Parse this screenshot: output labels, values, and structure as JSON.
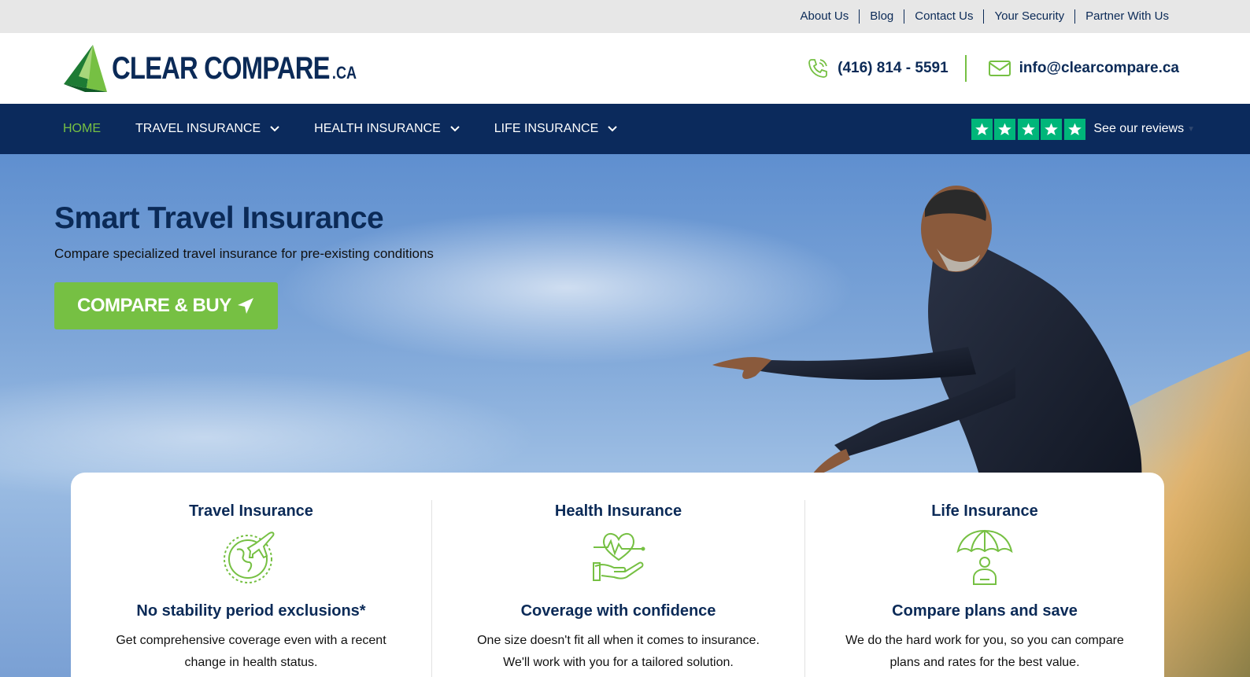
{
  "utility_links": [
    "About Us",
    "Blog",
    "Contact Us",
    "Your Security",
    "Partner With Us"
  ],
  "logo": {
    "main": "CLEAR COMPARE",
    "suffix": ".CA"
  },
  "contact": {
    "phone": "(416) 814 - 5591",
    "email": "info@clearcompare.ca"
  },
  "nav": {
    "home": "HOME",
    "travel": "TRAVEL INSURANCE",
    "health": "HEALTH INSURANCE",
    "life": "LIFE INSURANCE",
    "reviews_label": "See our reviews",
    "reviews_stars": 5
  },
  "hero": {
    "title": "Smart Travel Insurance",
    "subtitle": "Compare specialized travel insurance for pre-existing conditions",
    "cta": "COMPARE & BUY"
  },
  "features": [
    {
      "title": "Travel Insurance",
      "icon": "globe-plane-icon",
      "heading": "No stability period exclusions*",
      "text": "Get comprehensive coverage even with a recent change in health status."
    },
    {
      "title": "Health Insurance",
      "icon": "heart-hand-icon",
      "heading": "Coverage with confidence",
      "text": "One size doesn't fit all when it comes to insurance. We'll work with you for a tailored solution."
    },
    {
      "title": "Life Insurance",
      "icon": "umbrella-person-icon",
      "heading": "Compare plans and save",
      "text": "We do the hard work for you, so you can compare plans and rates for the best value."
    }
  ],
  "colors": {
    "navy": "#0b2a5c",
    "green": "#76c043",
    "trustpilot": "#00b67a",
    "utility_bg": "#e7e7e7"
  }
}
